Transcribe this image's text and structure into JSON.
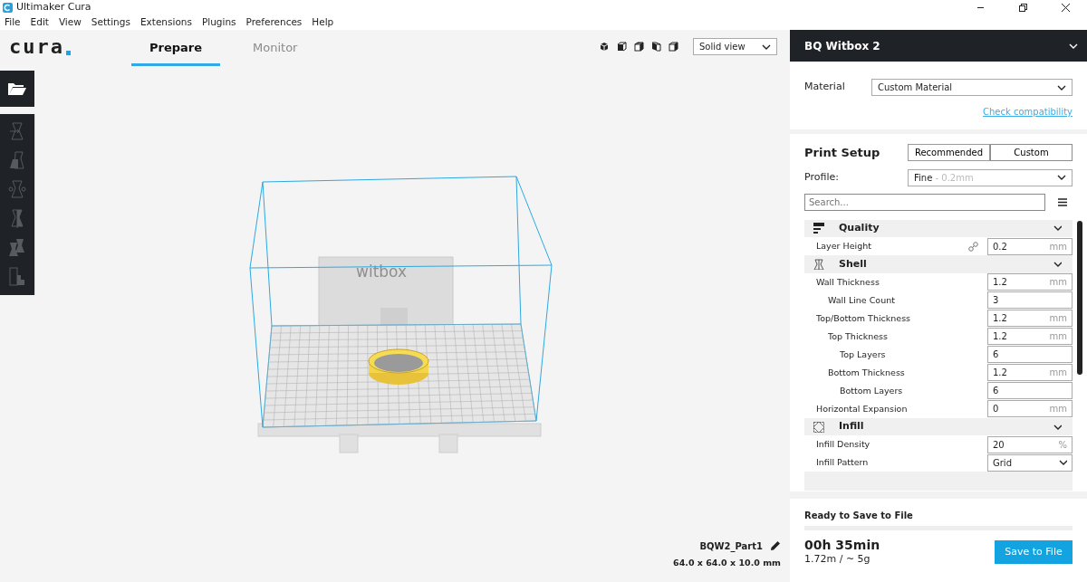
{
  "window": {
    "title": "Ultimaker Cura"
  },
  "menu": [
    "File",
    "Edit",
    "View",
    "Settings",
    "Extensions",
    "Plugins",
    "Preferences",
    "Help"
  ],
  "logo": "cura",
  "tabs": [
    {
      "label": "Prepare",
      "selected": true
    },
    {
      "label": "Monitor",
      "selected": false
    }
  ],
  "view_mode": {
    "value": "Solid view"
  },
  "toolbar": {
    "tools": [
      {
        "kind": "move",
        "disabled": true
      },
      {
        "kind": "scale",
        "disabled": true
      },
      {
        "kind": "rotate",
        "disabled": true
      },
      {
        "kind": "mirror",
        "disabled": true
      },
      {
        "kind": "per-model",
        "disabled": true
      },
      {
        "kind": "support",
        "disabled": true
      }
    ]
  },
  "scene": {
    "printer_text": "witbox"
  },
  "object": {
    "name": "BQW2_Part1",
    "dimensions": "64.0 x 64.0 x 10.0 mm"
  },
  "printer": {
    "name": "BQ Witbox 2"
  },
  "material": {
    "label": "Material",
    "value": "Custom Material",
    "link": "Check compatibility"
  },
  "print_setup": {
    "title": "Print Setup",
    "modes": [
      {
        "label": "Recommended",
        "selected": false
      },
      {
        "label": "Custom",
        "selected": true
      }
    ],
    "profile": {
      "label": "Profile:",
      "name": "Fine",
      "detail": " - 0.2mm"
    },
    "search": {
      "placeholder": "Search..."
    }
  },
  "settings": [
    {
      "kind": "category",
      "label": "Quality",
      "expanded": true,
      "children": [
        {
          "kind": "number",
          "label": "Layer Height",
          "value": "0.2",
          "unit": "mm",
          "linked": true
        }
      ]
    },
    {
      "kind": "category",
      "label": "Shell",
      "expanded": true,
      "children": [
        {
          "kind": "number",
          "label": "Wall Thickness",
          "value": "1.2",
          "unit": "mm",
          "linked": false,
          "children": [
            {
              "kind": "number",
              "label": "Wall Line Count",
              "value": "3",
              "linked": false
            }
          ]
        },
        {
          "kind": "number",
          "label": "Top/Bottom Thickness",
          "value": "1.2",
          "unit": "mm",
          "linked": false,
          "children": [
            {
              "kind": "number",
              "label": "Top Thickness",
              "value": "1.2",
              "unit": "mm",
              "linked": false,
              "children": [
                {
                  "kind": "number",
                  "label": "Top Layers",
                  "value": "6",
                  "linked": false
                }
              ]
            },
            {
              "kind": "number",
              "label": "Bottom Thickness",
              "value": "1.2",
              "unit": "mm",
              "linked": false,
              "children": [
                {
                  "kind": "number",
                  "label": "Bottom Layers",
                  "value": "6",
                  "linked": false
                }
              ]
            }
          ]
        },
        {
          "kind": "number",
          "label": "Horizontal Expansion",
          "value": "0",
          "unit": "mm",
          "linked": false
        }
      ]
    },
    {
      "kind": "category",
      "label": "Infill",
      "expanded": true,
      "children": [
        {
          "kind": "number",
          "label": "Infill Density",
          "value": "20",
          "unit": "%",
          "linked": false
        },
        {
          "kind": "select",
          "label": "Infill Pattern",
          "value": "Grid",
          "linked": false
        }
      ]
    }
  ],
  "status": {
    "title": "Ready to Save to File",
    "time": "00h 35min",
    "usage": "1.72m / ~ 5g",
    "button": "Save to File"
  }
}
